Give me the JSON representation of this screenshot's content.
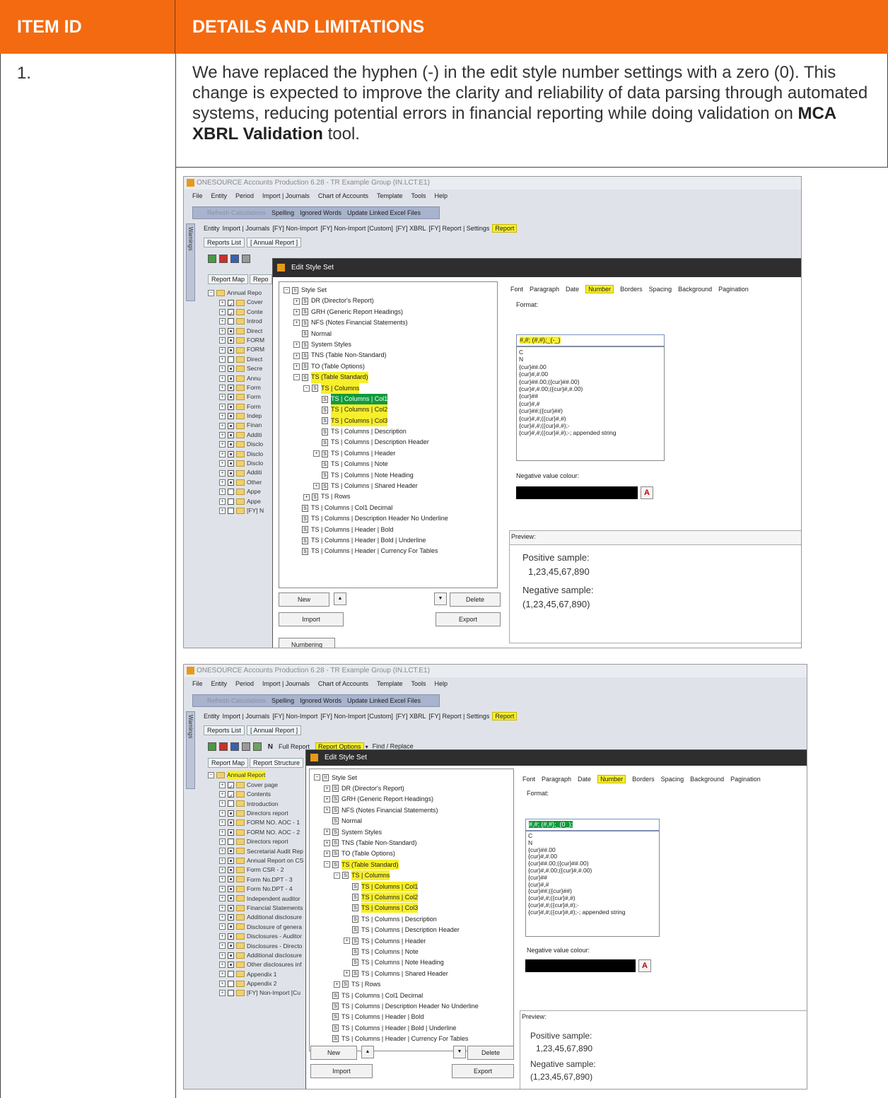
{
  "table": {
    "header": {
      "item_id": "ITEM ID",
      "details": "DETAILS AND LIMITATIONS"
    },
    "row": {
      "item_id": "1.",
      "details_before": "We have replaced the hyphen (-) in the edit style number settings with a zero (0). This change is expected to improve the clarity and reliability of data parsing through automated systems, reducing potential errors in financial reporting while doing validation on ",
      "details_bold": "MCA XBRL Validation",
      "details_after": " tool."
    }
  },
  "colors": {
    "header_bg": "#f46a10",
    "highlight": "#f7ef2a",
    "selected": "#109a3e"
  },
  "app": {
    "title": "ONESOURCE Accounts Production 6.28 - TR Example Group (IN.LCT.E1)",
    "menu": [
      "File",
      "Entity",
      "Period",
      "Import | Journals",
      "Chart of Accounts",
      "Template",
      "Tools",
      "Help"
    ],
    "toolbar": [
      "Refresh Calculations",
      "Spelling",
      "Ignored Words",
      "Update Linked Excel Files"
    ],
    "warnings_tab": "Warnings",
    "tabs": [
      "Entity",
      "Import | Journals",
      "[FY] Non-Import",
      "[FY] Non-Import [Custom]",
      "[FY] XBRL",
      "[FY] Report | Settings",
      "Report"
    ],
    "subtabs": [
      "Reports List",
      "[ Annual Report ]"
    ],
    "report_toolbar": [
      "N",
      "Full Report",
      "Report Options",
      "Find / Replace"
    ],
    "map_tabs": [
      "Report Map",
      "Report Structure"
    ],
    "report_tree": [
      "Annual Report",
      "Cover page",
      "Contents",
      "Introduction",
      "Directors report",
      "FORM NO. AOC - 1",
      "FORM NO. AOC - 2",
      "Directors report",
      "Secretarial Audit Rep",
      "Annual Report on CS",
      "Form CSR - 2",
      "Form No.DPT - 3",
      "Form No.DPT - 4",
      "Independent auditor",
      "Financial Statements",
      "Additional disclosure",
      "Disclosure of genera",
      "Disclosures - Auditor",
      "Disclosures - Directo",
      "Additional disclosure",
      "Other disclosures inf",
      "Appendix 1",
      "Appendix 2",
      "[FY] Non-Import [Cu"
    ],
    "report_tree_short": [
      "Annual Repo",
      "Cover",
      "Conte",
      "Introd",
      "Direct",
      "FORM",
      "FORM",
      "Direct",
      "Secre",
      "Annu",
      "Form",
      "Form",
      "Form",
      "Indep",
      "Finan",
      "Additi",
      "Disclo",
      "Disclo",
      "Disclo",
      "Additi",
      "Other",
      "Appe",
      "Appe",
      "[FY] N"
    ],
    "map_tabs_short": [
      "Report Map",
      "Repo"
    ]
  },
  "dialog": {
    "title": "Edit Style Set",
    "style_tree": [
      "Style Set",
      "DR (Director's Report)",
      "GRH (Generic Report Headings)",
      "NFS (Notes Financial Statements)",
      "Normal",
      "System Styles",
      "TNS (Table Non-Standard)",
      "TO (Table Options)",
      "TS (Table Standard)",
      "TS | Columns",
      "TS | Columns | Col1",
      "TS | Columns | Col2",
      "TS | Columns | Col3",
      "TS | Columns | Description",
      "TS | Columns | Description Header",
      "TS | Columns | Header",
      "TS | Columns | Note",
      "TS | Columns | Note Heading",
      "TS | Columns | Shared Header",
      "TS | Rows",
      "TS | Columns | Col1 Decimal",
      "TS | Columns | Description Header No Underline",
      "TS | Columns | Header | Bold",
      "TS | Columns | Header | Bold | Underline",
      "TS | Columns | Header | Currency For Tables"
    ],
    "tabs": [
      "Font",
      "Paragraph",
      "Date",
      "Number",
      "Borders",
      "Spacing",
      "Background",
      "Pagination"
    ],
    "format_label": "Format:",
    "format_before": "#,#; (#,#);_(-_)",
    "format_after": "#,#; (#,#);_(0_);",
    "format_list": [
      "C",
      "N",
      "{cur}##.00",
      "{cur}#,#.00",
      "{cur}##.00;({cur}##.00)",
      "{cur}#,#.00;({cur}#,#.00)",
      "{cur}##",
      "{cur}#,#",
      "{cur}##;({cur}##)",
      "{cur}#,#;({cur}#,#)",
      "{cur}#,#;({cur}#,#);-",
      "{cur}#,#;({cur}#,#);-; appended string"
    ],
    "neg_colour_label": "Negative value colour:",
    "preview_label": "Preview:",
    "positive_label": "Positive sample:",
    "positive_value": "1,23,45,67,890",
    "negative_label": "Negative sample:",
    "negative_value": "(1,23,45,67,890)",
    "buttons": {
      "new": "New",
      "delete": "Delete",
      "import": "Import",
      "export": "Export",
      "numbering": "Numbering"
    }
  }
}
